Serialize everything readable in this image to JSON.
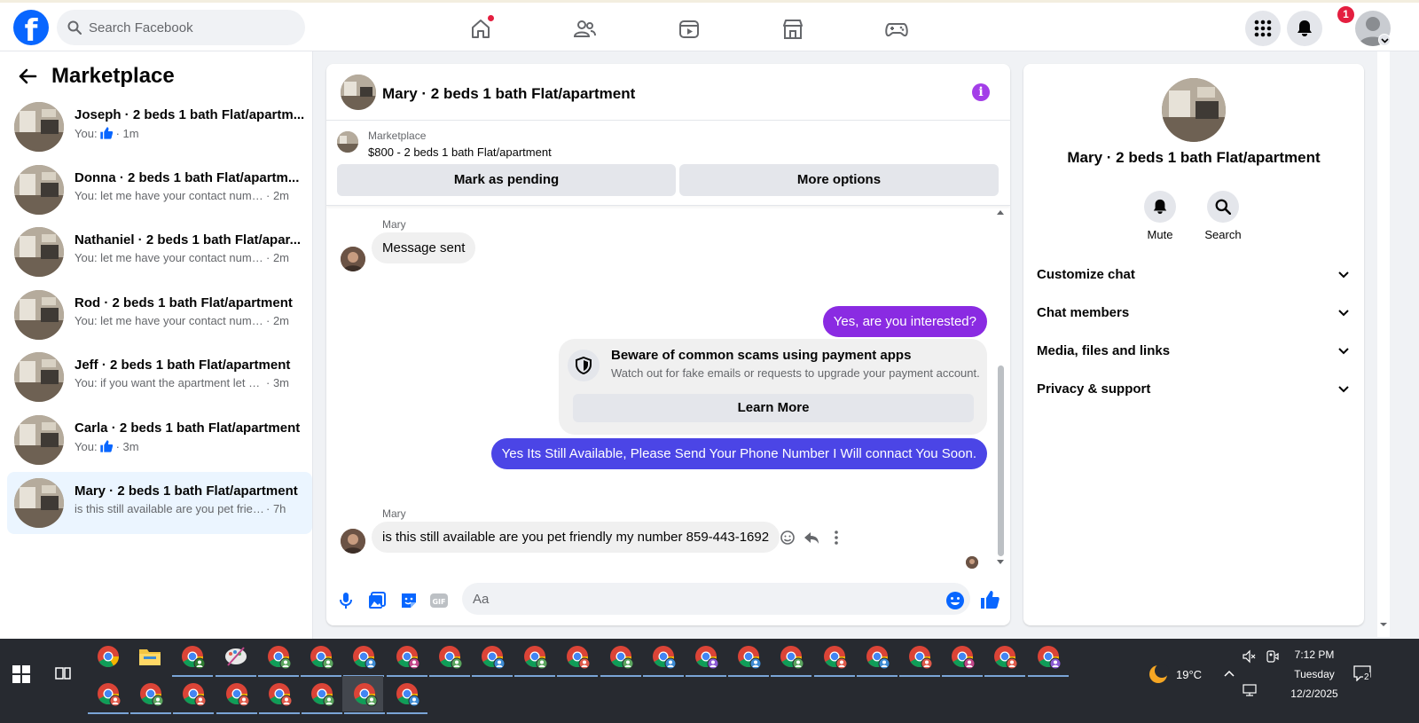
{
  "topbar": {
    "search_placeholder": "Search Facebook",
    "notification_count": "1"
  },
  "sidebar": {
    "title": "Marketplace",
    "conversations": [
      {
        "name": "Joseph · 2 beds 1 bath Flat/apartm...",
        "snippet_prefix": "You:",
        "snippet": "",
        "time": "· 1m",
        "like": true
      },
      {
        "name": "Donna · 2 beds 1 bath Flat/apartm...",
        "snippet_prefix": "",
        "snippet": "You: let me have your contact numbe...",
        "time": "· 2m",
        "like": false
      },
      {
        "name": "Nathaniel · 2 beds 1 bath Flat/apar...",
        "snippet_prefix": "",
        "snippet": "You: let me have your contact numbe...",
        "time": "· 2m",
        "like": false
      },
      {
        "name": "Rod · 2 beds 1 bath Flat/apartment",
        "snippet_prefix": "",
        "snippet": "You: let me have your contact numbe...",
        "time": "· 2m",
        "like": false
      },
      {
        "name": "Jeff · 2 beds 1 bath Flat/apartment",
        "snippet_prefix": "",
        "snippet": "You: if you want the apartment let m...",
        "time": "· 3m",
        "like": false
      },
      {
        "name": "Carla · 2 beds 1 bath Flat/apartment",
        "snippet_prefix": "You:",
        "snippet": "",
        "time": "· 3m",
        "like": true
      },
      {
        "name": "Mary · 2 beds 1 bath Flat/apartment",
        "snippet_prefix": "",
        "snippet": "is this still available are you pet friendl...",
        "time": "· 7h",
        "like": false
      }
    ]
  },
  "chat": {
    "title": "Mary · 2 beds 1 bath Flat/apartment",
    "listing_category": "Marketplace",
    "listing_price": "$800 - 2 beds 1 bath Flat/apartment",
    "mark_pending": "Mark as pending",
    "more_options": "More options",
    "sender1": "Mary",
    "msg1": "Message sent",
    "out1": "Yes, are you interested?",
    "scam_title": "Beware of common scams using payment apps",
    "scam_desc": "Watch out for fake emails or requests to upgrade your payment account.",
    "learn_more": "Learn More",
    "out2": "Yes Its Still Available, Please Send Your Phone Number I Will connact You Soon.",
    "sender2": "Mary",
    "msg2": "is this still available are you pet friendly my number 859-443-1692",
    "input_placeholder": "Aa",
    "out_colors": [
      "#8a2be2",
      "#5c3ee8"
    ]
  },
  "right_panel": {
    "title": "Mary · 2 beds 1 bath Flat/apartment",
    "mute": "Mute",
    "search": "Search",
    "sections": [
      "Customize chat",
      "Chat members",
      "Media, files and links",
      "Privacy & support"
    ]
  },
  "taskbar": {
    "temperature": "19°C",
    "time": "7:12 PM",
    "day": "Tuesday",
    "date": "12/2/2025",
    "notif_count": "2"
  },
  "colors": {
    "brand": "#0866ff",
    "accent_purple": "#8a2be2",
    "notification_red": "#e41e3f"
  }
}
